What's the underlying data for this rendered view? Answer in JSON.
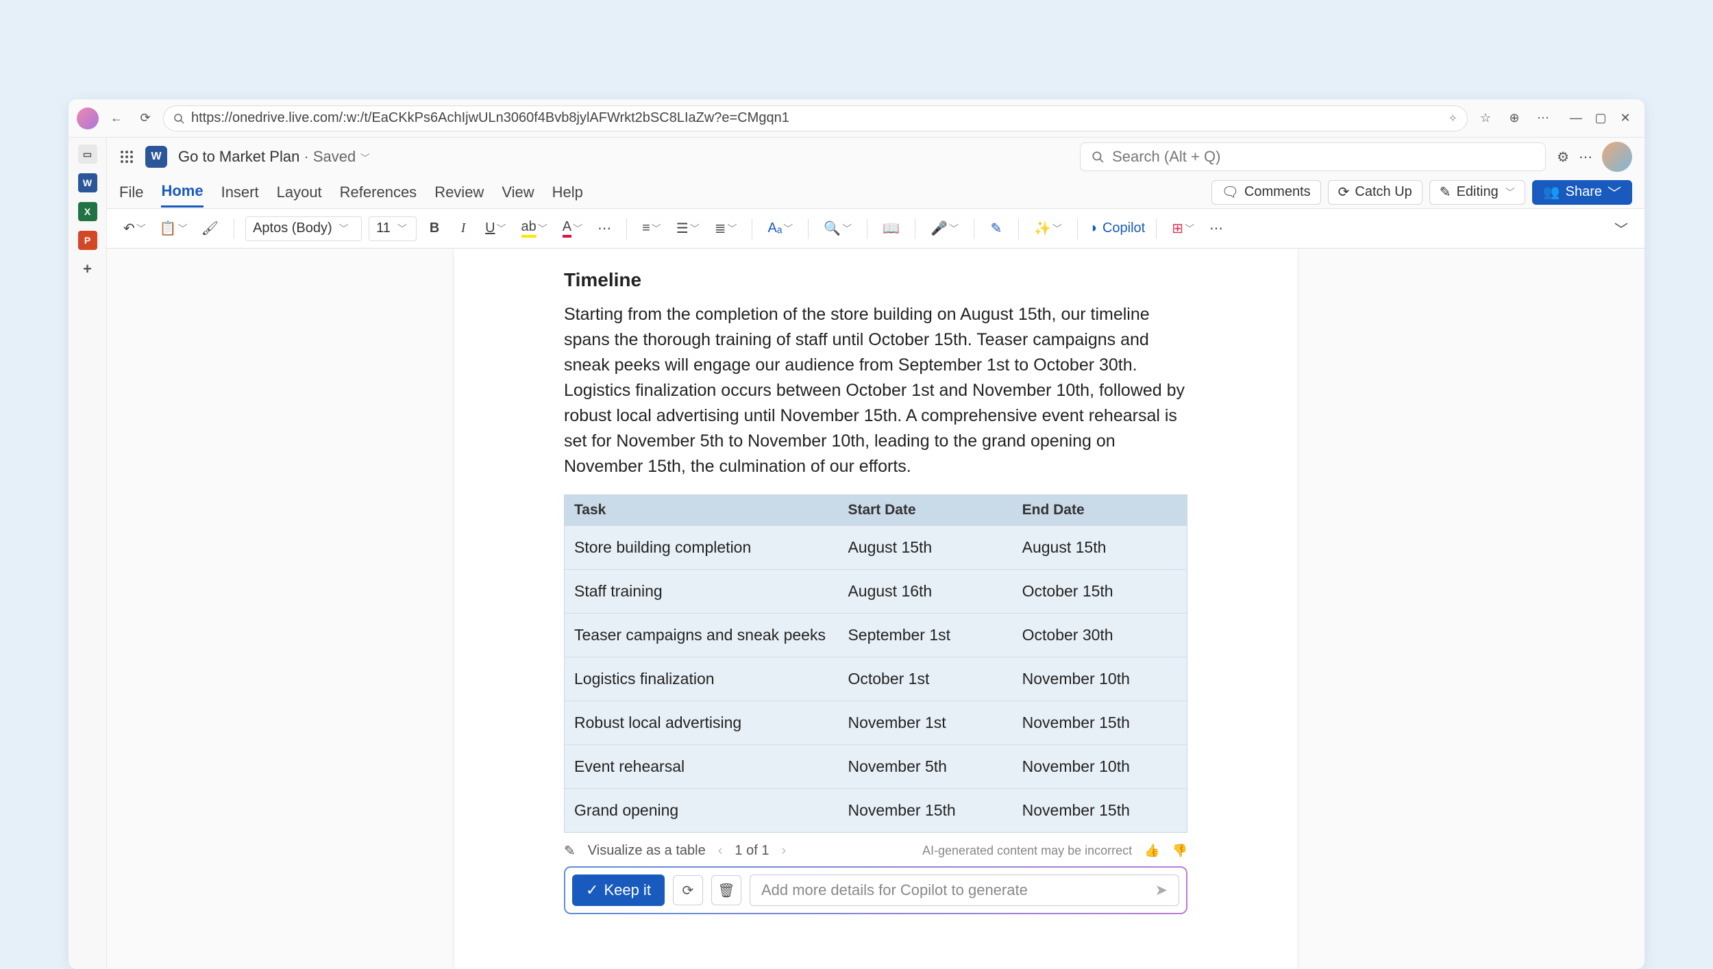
{
  "browser": {
    "url": "https://onedrive.live.com/:w:/t/EaCKkPs6AchIjwULn3060f4Bvb8jylAFWrkt2bSC8LIaZw?e=CMgqn1"
  },
  "title_row": {
    "doc_name": "Go to Market Plan",
    "saved_label": " · Saved",
    "search_placeholder": "Search (Alt + Q)"
  },
  "tabs": {
    "file": "File",
    "home": "Home",
    "insert": "Insert",
    "layout": "Layout",
    "references": "References",
    "review": "Review",
    "view": "View",
    "help": "Help",
    "comments": "Comments",
    "catch_up": "Catch Up",
    "editing": "Editing",
    "share": "Share"
  },
  "ribbon": {
    "font": "Aptos (Body)",
    "size": "11",
    "copilot": "Copilot"
  },
  "document": {
    "heading": "Timeline",
    "paragraph": "Starting from the completion of the store building on August 15th, our timeline spans the thorough training of staff until October 15th. Teaser campaigns and sneak peeks will engage our audience from September 1st to October 30th. Logistics finalization occurs between October 1st and November 10th, followed by robust local advertising until November 15th. A comprehensive event rehearsal is set for November 5th to November 10th, leading to the grand opening on November 15th, the culmination of our efforts.",
    "headers": {
      "task": "Task",
      "start": "Start Date",
      "end": "End Date"
    },
    "rows": [
      {
        "task": "Store building completion",
        "start": "August 15th",
        "end": "August 15th"
      },
      {
        "task": "Staff training",
        "start": "August 16th",
        "end": "October 15th"
      },
      {
        "task": "Teaser campaigns and sneak peeks",
        "start": "September 1st",
        "end": "October 30th"
      },
      {
        "task": "Logistics finalization",
        "start": "October 1st",
        "end": "November 10th"
      },
      {
        "task": "Robust local advertising",
        "start": "November 1st",
        "end": "November 15th"
      },
      {
        "task": "Event rehearsal",
        "start": "November 5th",
        "end": "November 10th"
      },
      {
        "task": "Grand opening",
        "start": "November 15th",
        "end": "November 15th"
      }
    ]
  },
  "ai_bar": {
    "visualize": "Visualize as a table",
    "pager": "1 of 1",
    "disclaimer": "AI-generated content may be incorrect"
  },
  "copilot_panel": {
    "keep": "Keep it",
    "placeholder": "Add more details for Copilot to generate"
  }
}
